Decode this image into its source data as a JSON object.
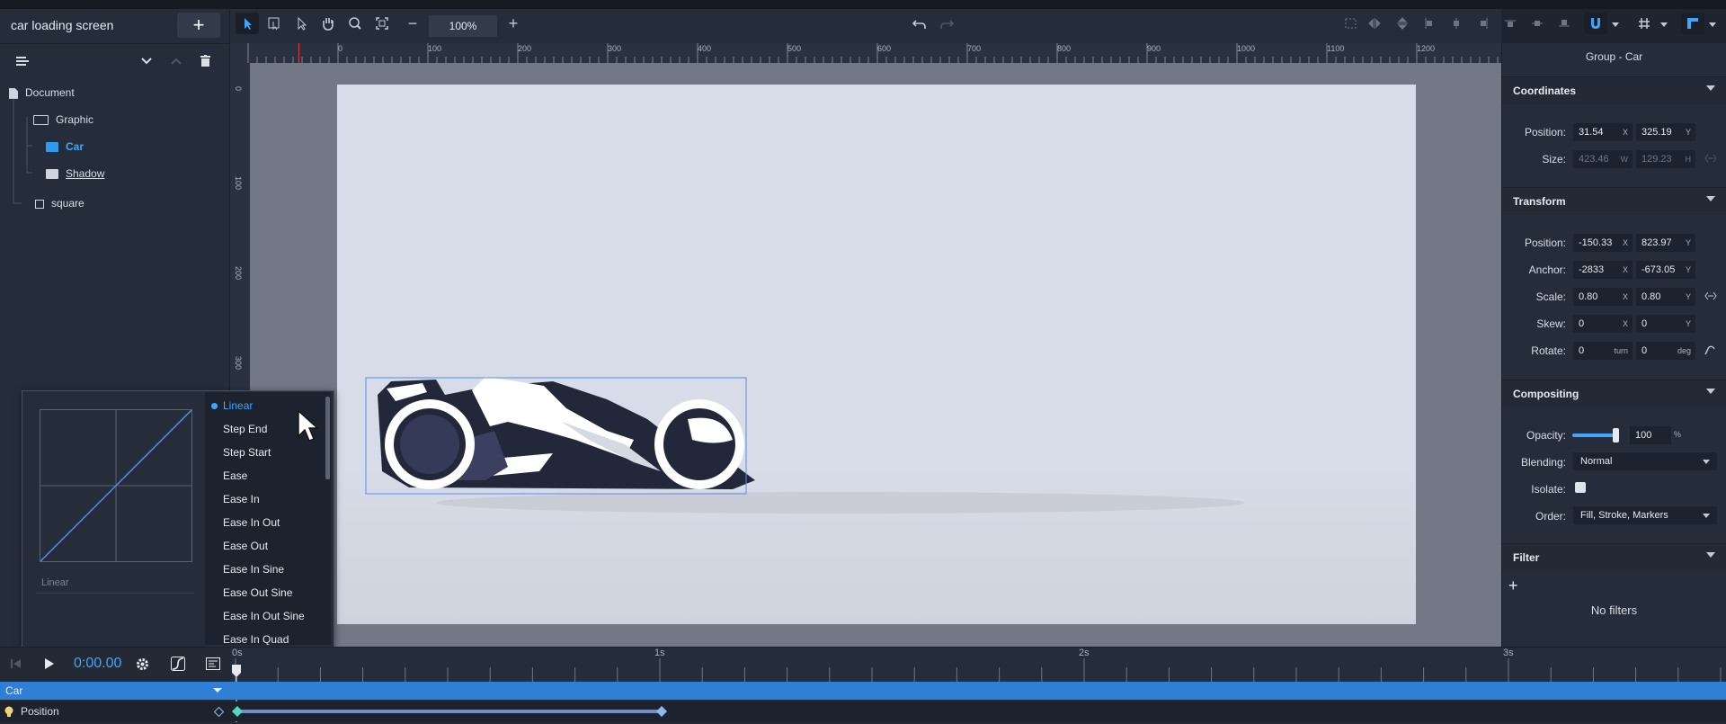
{
  "app": {
    "document_title": "car loading screen",
    "add_label": "+"
  },
  "layers": {
    "items": [
      {
        "label": "Document"
      },
      {
        "label": "Graphic"
      },
      {
        "label": "Car"
      },
      {
        "label": "Shadow"
      },
      {
        "label": "square"
      }
    ]
  },
  "toolbar": {
    "zoom_value": "100%",
    "zoom_out_label": "−",
    "zoom_in_label": "+"
  },
  "ruler": {
    "top": [
      "0",
      "100",
      "200",
      "300",
      "400",
      "500",
      "600",
      "700",
      "800",
      "900",
      "1000",
      "1100",
      "1200"
    ],
    "left": [
      "0",
      "100",
      "200",
      "300"
    ]
  },
  "inspector": {
    "title": "Group - Car",
    "coordinates": {
      "header": "Coordinates",
      "position_label": "Position:",
      "position_x": "31.54",
      "position_y": "325.19",
      "size_label": "Size:",
      "size_w": "423.46",
      "size_h": "129.23",
      "x": "X",
      "y": "Y",
      "w": "W",
      "h": "H"
    },
    "transform": {
      "header": "Transform",
      "position_label": "Position:",
      "position_x": "-150.33",
      "position_y": "823.97",
      "anchor_label": "Anchor:",
      "anchor_x": "-2833",
      "anchor_y": "-673.05",
      "scale_label": "Scale:",
      "scale_x": "0.80",
      "scale_y": "0.80",
      "skew_label": "Skew:",
      "skew_x": "0",
      "skew_y": "0",
      "rotate_label": "Rotate:",
      "rotate_turn": "0",
      "rotate_deg": "0",
      "turn_unit": "turn",
      "deg_unit": "deg"
    },
    "compositing": {
      "header": "Compositing",
      "opacity_label": "Opacity:",
      "opacity_value": "100",
      "opacity_unit": "%",
      "opacity_level": 1.0,
      "blending_label": "Blending:",
      "blending_value": "Normal",
      "isolate_label": "Isolate:",
      "order_label": "Order:",
      "order_value": "Fill, Stroke, Markers"
    },
    "filter": {
      "header": "Filter",
      "add_label": "+",
      "empty_text": "No filters"
    }
  },
  "easing": {
    "selected": "Linear",
    "graph_caption": "Linear",
    "options": [
      "Linear",
      "Step End",
      "Step Start",
      "Ease",
      "Ease In",
      "Ease In Out",
      "Ease Out",
      "Ease In Sine",
      "Ease Out Sine",
      "Ease In Out Sine",
      "Ease In Quad"
    ]
  },
  "timeline": {
    "time": "0:00.00",
    "marks": [
      "0s",
      "1s",
      "2s",
      "3s"
    ],
    "track_group": "Car",
    "track_property": "Position"
  },
  "colors": {
    "accent": "#3ea6ff",
    "panel": "#262d3a",
    "track": "#2f7fd6",
    "keyframe": "#8fb8ef"
  }
}
